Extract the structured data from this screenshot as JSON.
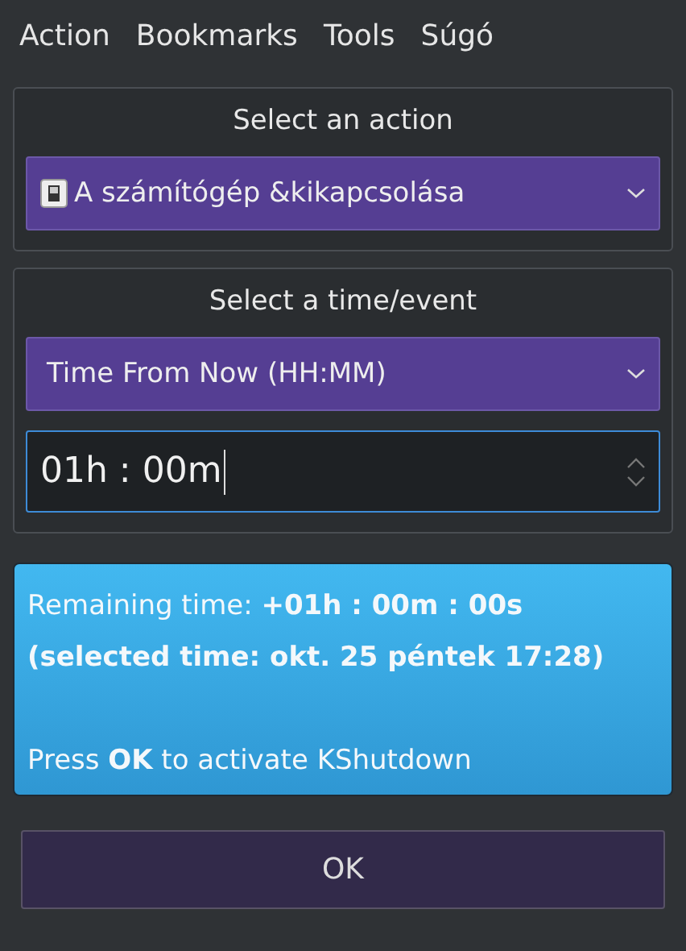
{
  "menu_bar": [
    "Action",
    "Bookmarks",
    "Tools",
    "Súgó"
  ],
  "action_group": {
    "title": "Select an action",
    "combo": {
      "value": "A számítógép &kikapcsolása"
    }
  },
  "time_group": {
    "title": "Select a time/event",
    "combo": {
      "value": "Time From Now (HH:MM)"
    },
    "time_field": {
      "value": "01h : 00m",
      "focused": true
    }
  },
  "info": {
    "remaining": "Remaining time: **+01h : 00m : 00s**",
    "selected_time": "(selected time: okt. 25 péntek 17:28)",
    "hint": "Press **OK** to activate KShutdown"
  },
  "ok_button": "OK"
}
